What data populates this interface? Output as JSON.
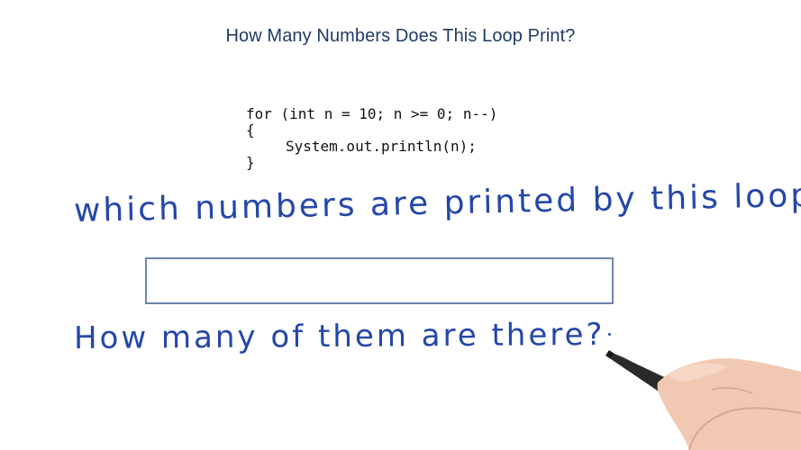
{
  "title": "How Many Numbers Does This Loop Print?",
  "code": {
    "lines": [
      "for (int n = 10; n >= 0; n--)",
      "{",
      "System.out.println(n);",
      "}"
    ]
  },
  "questions": {
    "q1": "which numbers are printed by this loop?",
    "q2": "How many of them are there?"
  },
  "answer": {
    "value": "",
    "placeholder": ""
  },
  "colors": {
    "title": "#1f3b63",
    "handwriting": "#2447a8",
    "box_border": "#6d86ad",
    "code": "#111111"
  },
  "icons": {
    "hand": "hand-holding-marker-icon"
  }
}
